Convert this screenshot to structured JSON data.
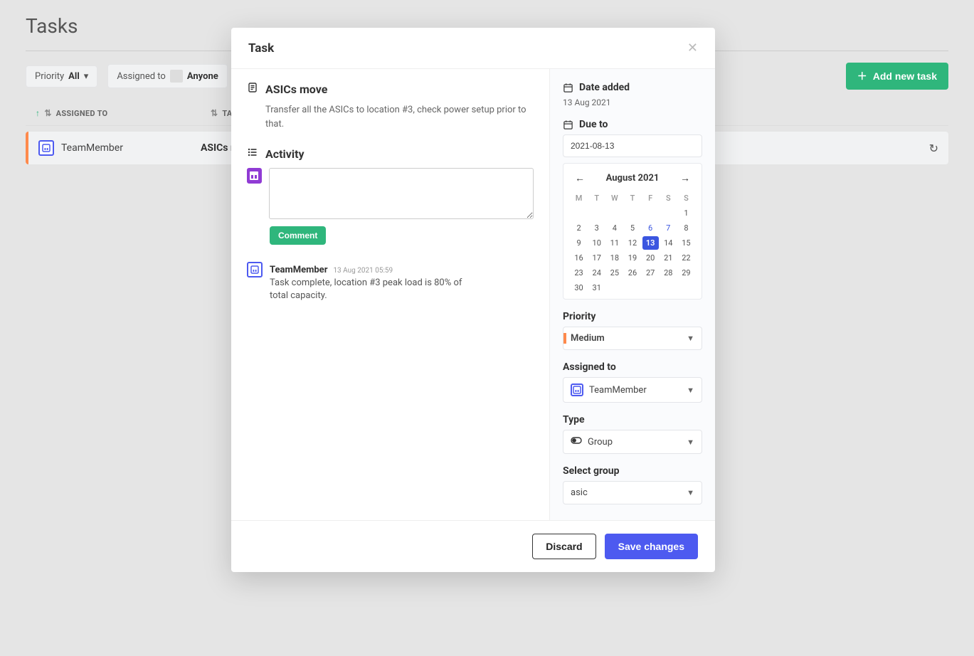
{
  "page": {
    "title": "Tasks",
    "filters": {
      "priority_label": "Priority",
      "priority_value": "All",
      "assigned_label": "Assigned to",
      "assigned_value": "Anyone"
    },
    "add_button": "Add new task",
    "columns": {
      "assigned": "ASSIGNED TO",
      "task": "TASK"
    },
    "row": {
      "assignee": "TeamMember",
      "task": "ASICs move"
    }
  },
  "modal": {
    "header": "Task",
    "task_title": "ASICs move",
    "task_desc": "Transfer all the ASICs to location #3, check power setup prior to that.",
    "activity_label": "Activity",
    "comment_btn": "Comment",
    "comment": {
      "author": "TeamMember",
      "date": "13 Aug 2021 05:59",
      "text": "Task complete, location #3 peak load is 80% of total capacity."
    },
    "side": {
      "date_added_label": "Date added",
      "date_added": "13 Aug 2021",
      "due_label": "Due to",
      "due_value": "2021-08-13",
      "calendar": {
        "month": "August 2021",
        "dow": [
          "M",
          "T",
          "W",
          "T",
          "F",
          "S",
          "S"
        ],
        "selected_day": 13
      },
      "priority_label": "Priority",
      "priority_value": "Medium",
      "assigned_label": "Assigned to",
      "assigned_value": "TeamMember",
      "type_label": "Type",
      "type_value": "Group",
      "select_group_label": "Select group",
      "select_group_value": "asic"
    },
    "footer": {
      "discard": "Discard",
      "save": "Save changes"
    }
  }
}
